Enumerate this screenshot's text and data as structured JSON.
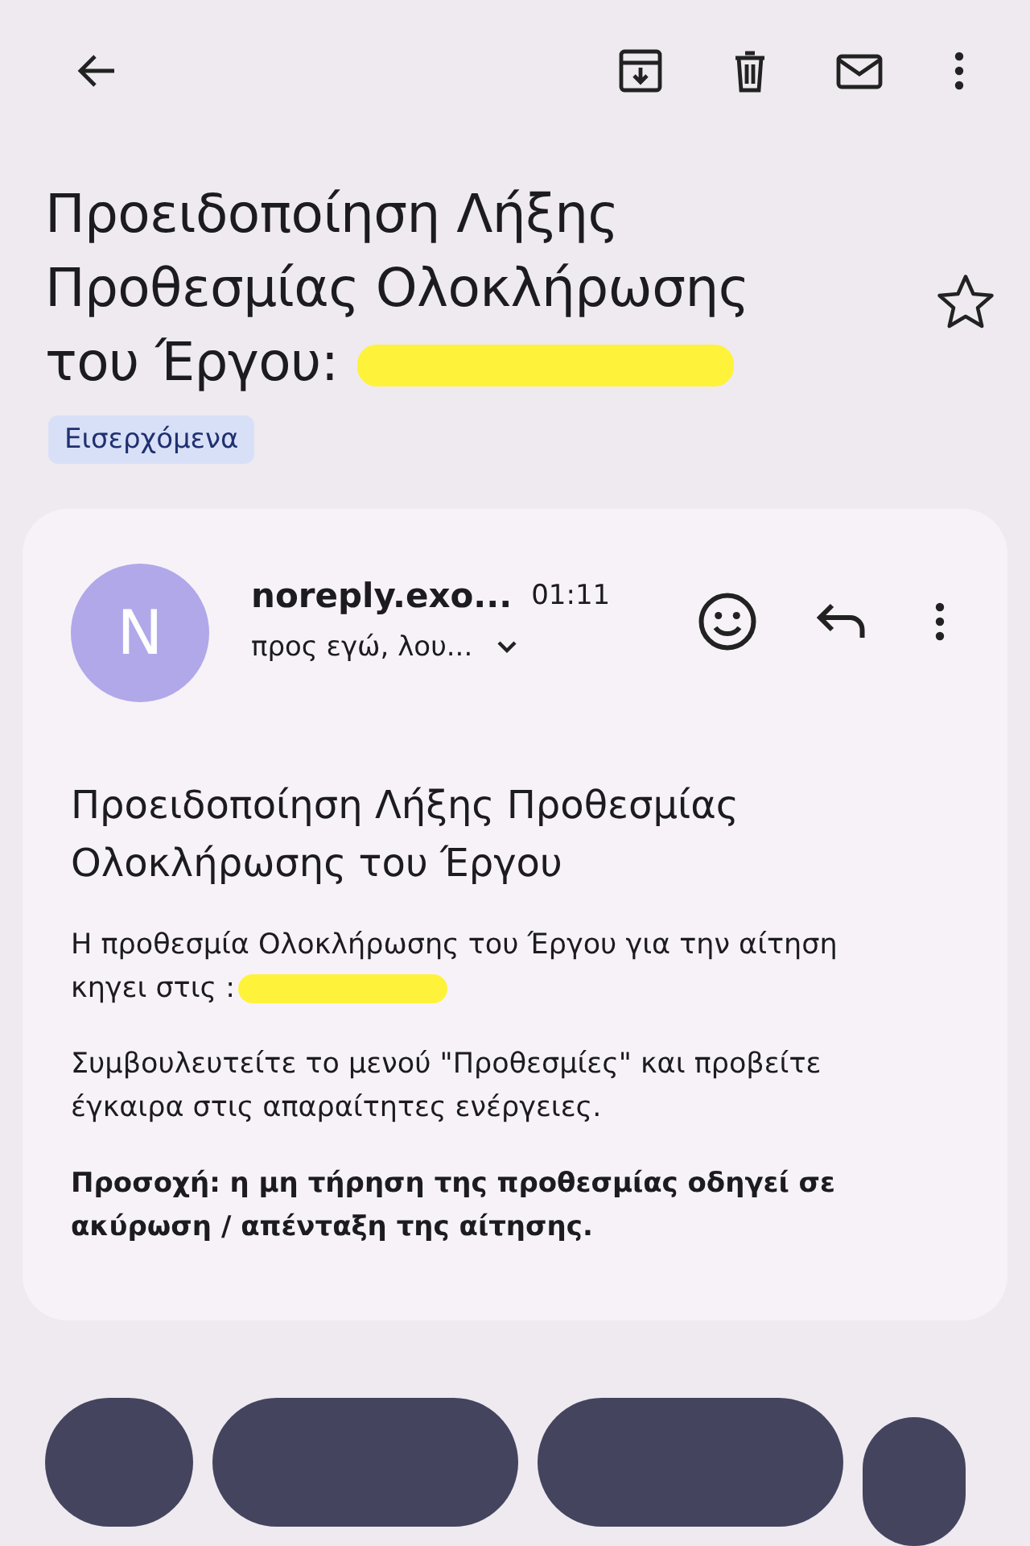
{
  "toolbar": {
    "actions": [
      {
        "kind": "archive"
      },
      {
        "kind": "delete"
      },
      {
        "kind": "unread"
      },
      {
        "kind": "more"
      }
    ]
  },
  "subject": "Προειδοποίηση Λήξης Προθεσμίας Ολοκλήρωσης του Έργου:",
  "starred": false,
  "label": "Εισερχόμενα",
  "message": {
    "avatar": "N",
    "sender": "noreply.exo...",
    "time": "01:11",
    "recipients": "προς εγώ, λου...",
    "heading": "Προειδοποίηση Λήξης Προθεσμίας Ολοκλήρωσης του Έργου",
    "paragraphs": [
      {
        "text": "Η προθεσμία Ολοκλήρωσης του Έργου για την αίτηση κηγει στις :",
        "redacted": true,
        "bold": false
      },
      {
        "text": "Συμβουλευτείτε το μενού \"Προθεσμίες\" και προβείτε έγκαιρα στις απαραίτητες ενέργειες.",
        "redacted": false,
        "bold": false
      },
      {
        "text": "Προσοχή: η μη τήρηση της προθεσμίας οδηγεί σε ακύρωση / απένταξη της αίτησης.",
        "redacted": false,
        "bold": true
      }
    ]
  },
  "bottom_buttons": [
    {
      "kind": "round"
    },
    {
      "kind": "pill"
    },
    {
      "kind": "pill"
    },
    {
      "kind": "small"
    }
  ]
}
